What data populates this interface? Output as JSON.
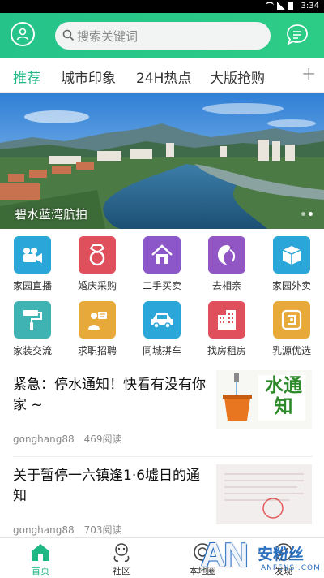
{
  "status_bar": {
    "time": "3:34"
  },
  "header": {
    "search_placeholder": "搜索关键词"
  },
  "tabs": [
    {
      "label": "推荐",
      "active": true
    },
    {
      "label": "城市印象"
    },
    {
      "label": "24H热点"
    },
    {
      "label": "大版抢购"
    }
  ],
  "tabs_more": "+",
  "banner": {
    "caption": "碧水蓝湾航拍",
    "slide_count": 2,
    "active_slide": 2
  },
  "grid": [
    {
      "label": "家园直播",
      "icon": "video-camera-icon",
      "color": "#2ba6d9"
    },
    {
      "label": "婚庆采购",
      "icon": "ring-icon",
      "color": "#e0505c"
    },
    {
      "label": "二手买卖",
      "icon": "house-icon",
      "color": "#8b57c9"
    },
    {
      "label": "去相亲",
      "icon": "heart-face-icon",
      "color": "#9156c4"
    },
    {
      "label": "家园外卖",
      "icon": "package-icon",
      "color": "#2ba6d9"
    },
    {
      "label": "家装交流",
      "icon": "paint-roller-icon",
      "color": "#3fb2b3"
    },
    {
      "label": "求职招聘",
      "icon": "job-person-icon",
      "color": "#e7a93a"
    },
    {
      "label": "同城拼车",
      "icon": "car-icon",
      "color": "#2ba6d9"
    },
    {
      "label": "找房租房",
      "icon": "building-icon",
      "color": "#e0505c"
    },
    {
      "label": "乳源优选",
      "icon": "shopping-tag-icon",
      "color": "#e7a93a"
    }
  ],
  "news": [
    {
      "title": "紧急：停水通知！快看有没有你家 ~",
      "author": "gonghang88",
      "reads": "469阅读",
      "thumb_text": "水通知"
    },
    {
      "title": "关于暂停一六镇逢1·6墟日的通知",
      "author": "gonghang88",
      "reads": "703阅读"
    }
  ],
  "bottom_nav": [
    {
      "label": "首页",
      "icon": "home-icon",
      "active": true
    },
    {
      "label": "社区",
      "icon": "community-icon"
    },
    {
      "label": "本地圈",
      "icon": "local-circle-icon"
    },
    {
      "label": "发现",
      "icon": "discover-icon"
    }
  ],
  "watermark": {
    "logo": "AN",
    "name": "安粉丝",
    "url": "ANFENSI.COM"
  },
  "colors": {
    "brand_green": "#25c38a",
    "active_tab": "#1fb783"
  }
}
